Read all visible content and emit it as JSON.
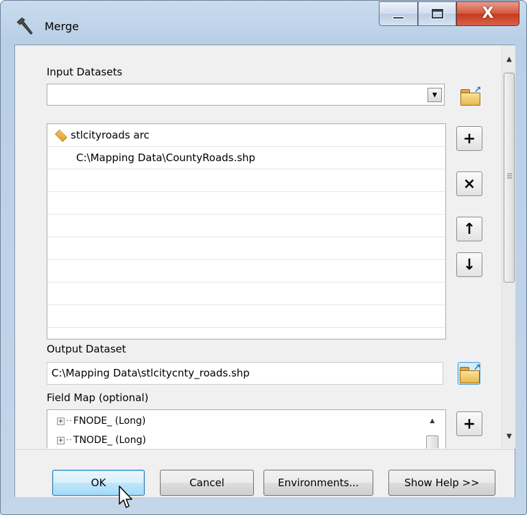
{
  "window": {
    "title": "Merge",
    "icons": {
      "app": "hammer-icon",
      "minimize": "minimize-icon",
      "maximize": "maximize-icon",
      "close": "close-icon"
    },
    "close_glyph": "X"
  },
  "input_datasets": {
    "label": "Input Datasets",
    "combo_value": "",
    "items": [
      {
        "text": "stlcityroads arc",
        "icon": "layer-icon"
      },
      {
        "text": "C:\\Mapping Data\\CountyRoads.shp",
        "icon": ""
      }
    ],
    "buttons": {
      "browse": "open-folder-icon",
      "add": "+",
      "remove": "×",
      "up": "↑",
      "down": "↓"
    }
  },
  "output_dataset": {
    "label": "Output Dataset",
    "value": "C:\\Mapping Data\\stlcitycnty_roads.shp"
  },
  "field_map": {
    "label": "Field Map (optional)",
    "rows": [
      "FNODE_ (Long)",
      "TNODE_ (Long)"
    ],
    "add": "+"
  },
  "footer": {
    "ok": "OK",
    "cancel": "Cancel",
    "environments": "Environments...",
    "show_help": "Show Help >>"
  },
  "colors": {
    "titlebar": "#c3d6ea",
    "close_button": "#c43a1f",
    "dialog_bg": "#f0f0f0",
    "default_button": "#bee6fd"
  }
}
